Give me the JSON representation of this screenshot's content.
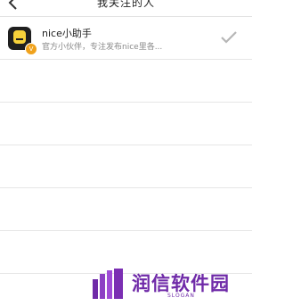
{
  "header": {
    "title": "我关注的人"
  },
  "following": [
    {
      "name": "nice小助手",
      "description": "官方小伙伴，专注发布nice里各...",
      "badge": "V"
    }
  ],
  "watermark": {
    "text": "润信软件园",
    "slogan": "SLOGAN"
  }
}
